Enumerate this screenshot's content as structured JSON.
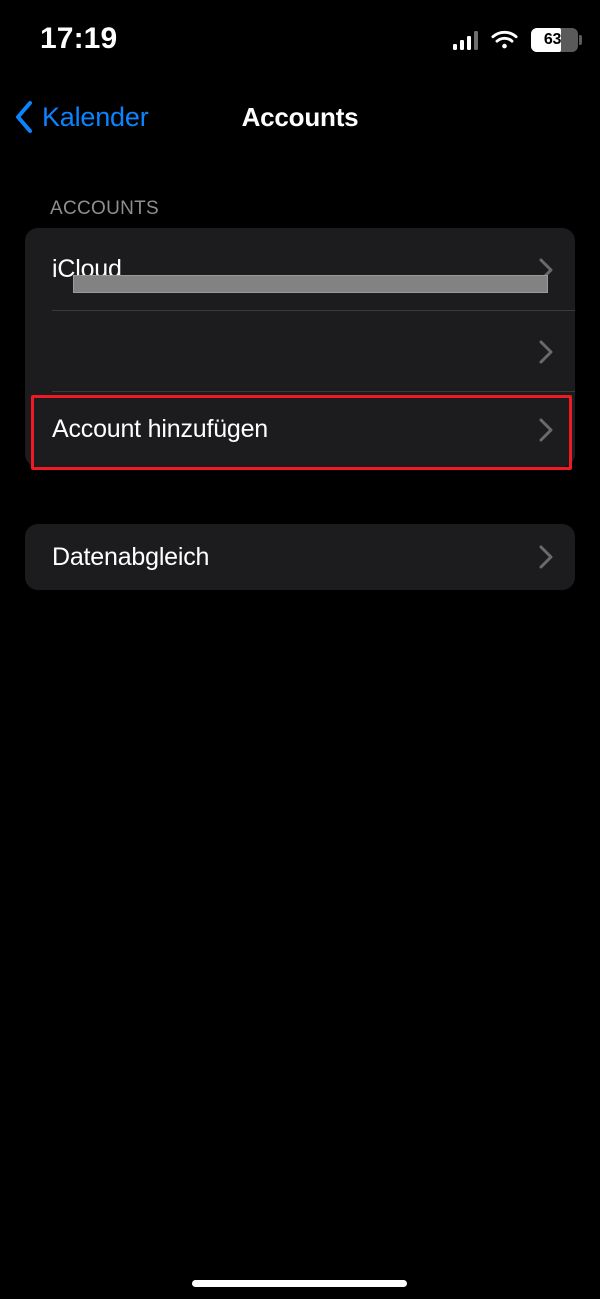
{
  "status_bar": {
    "time": "17:19",
    "cellular_icon": "cellular-bars-icon",
    "wifi_icon": "wifi-icon",
    "battery_icon": "battery-icon",
    "battery_percent": "63",
    "battery_level": 63
  },
  "nav_bar": {
    "back_icon": "chevron-left-icon",
    "back_label": "Kalender",
    "title": "Accounts"
  },
  "sections": [
    {
      "header": "ACCOUNTS",
      "rows": [
        {
          "title": "iCloud",
          "subtitle_redacted": true,
          "disclosure_icon": "chevron-right-icon"
        },
        {
          "title": "",
          "subtitle_redacted": false,
          "disclosure_icon": "chevron-right-icon"
        },
        {
          "title": "Account hinzufügen",
          "subtitle_redacted": false,
          "disclosure_icon": "chevron-right-icon",
          "highlighted": true
        }
      ]
    },
    {
      "header": "",
      "rows": [
        {
          "title": "Datenabgleich",
          "subtitle_redacted": false,
          "disclosure_icon": "chevron-right-icon"
        }
      ]
    }
  ],
  "colors": {
    "background": "#000000",
    "card": "#1c1c1e",
    "accent_blue": "#0a84ff",
    "separator": "#3a3a3c",
    "secondary_label": "#8e8e93",
    "highlight_red": "#ee1b24",
    "redaction_gray": "#828282"
  },
  "home_indicator": "home-indicator"
}
